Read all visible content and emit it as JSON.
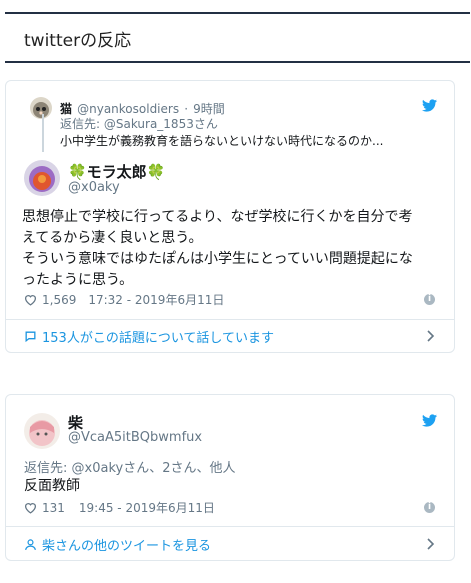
{
  "section": {
    "title": "twitterの反応"
  },
  "tweet1": {
    "quoted": {
      "name": "猫",
      "handle": "@nyankosoldiers",
      "time": "9時間",
      "replying_to": "返信先: @Sakura_1853さん",
      "text": "小中学生が義務教育を語らないといけない時代になるのか..."
    },
    "author": {
      "name": "🍀モラ太郎🍀",
      "handle": "@x0aky"
    },
    "lines": [
      "思想停止で学校に行ってるより、なぜ学校に行くかを自分で考",
      "えてるから凄く良いと思う。",
      "そういう意味ではゆたぽんは小学生にとっていい問題提起にな",
      "ったように思う。"
    ],
    "likes": "1,569",
    "timestamp": "17:32 - 2019年6月11日",
    "footer": "153人がこの話題について話しています"
  },
  "tweet2": {
    "author": {
      "name": "柴",
      "handle": "@VcaA5itBQbwmfux"
    },
    "replying_to": "返信先: @x0akyさん、2さん、他人",
    "text": "反面教師",
    "likes": "131",
    "timestamp": "19:45 - 2019年6月11日",
    "footer": "柴さんの他のツイートを見る"
  },
  "colors": {
    "twitter_blue": "#1b95e0",
    "rule": "#233044",
    "border": "#e1e8ed",
    "muted": "#657786"
  },
  "icons": [
    "twitter-bird-icon",
    "heart-icon",
    "info-icon",
    "speech-bubble-icon",
    "user-icon",
    "chevron-right-icon"
  ]
}
